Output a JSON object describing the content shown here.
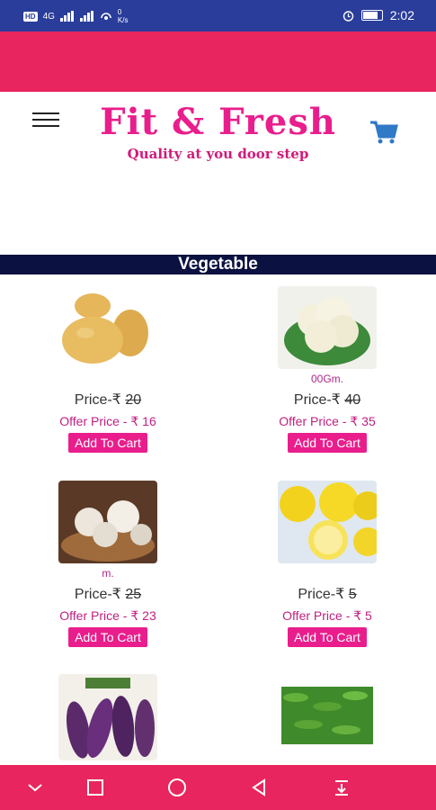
{
  "status_bar": {
    "network_badge": "HD",
    "signal_1": "4G",
    "speed_value": "0",
    "speed_unit": "K/s",
    "time": "2:02",
    "battery_level": 0.8
  },
  "header": {
    "title": "Fit & Fresh",
    "tagline": "Quality at you door step"
  },
  "category": {
    "title": "Vegetable"
  },
  "products": [
    {
      "name": "",
      "price_label": "Price-₹",
      "price": "20",
      "offer_label": "Offer Price - ₹",
      "offer_price": "16",
      "button": "Add To Cart",
      "image": "potato"
    },
    {
      "name": "00Gm.",
      "price_label": "Price-₹",
      "price": "40",
      "offer_label": "Offer Price - ₹",
      "offer_price": "35",
      "button": "Add To Cart",
      "image": "cauliflower"
    },
    {
      "name": "m.",
      "price_label": "Price-₹",
      "price": "25",
      "offer_label": "Offer Price - ₹",
      "offer_price": "23",
      "button": "Add To Cart",
      "image": "garlic"
    },
    {
      "name": "",
      "price_label": "Price-₹",
      "price": "5",
      "offer_label": "Offer Price - ₹",
      "offer_price": "5",
      "button": "Add To Cart",
      "image": "lemon"
    },
    {
      "name": "",
      "image": "brinjal"
    },
    {
      "name": "",
      "image": "green-chilli"
    }
  ],
  "colors": {
    "status_bar": "#2a3d9a",
    "accent_pink": "#e8255e",
    "button_pink": "#e91e8c",
    "category_bar": "#0b1140",
    "cart_blue": "#2f79c7"
  },
  "nav_icons": [
    "chevron-down-icon",
    "recent-apps-icon",
    "home-icon",
    "back-icon",
    "download-icon"
  ]
}
